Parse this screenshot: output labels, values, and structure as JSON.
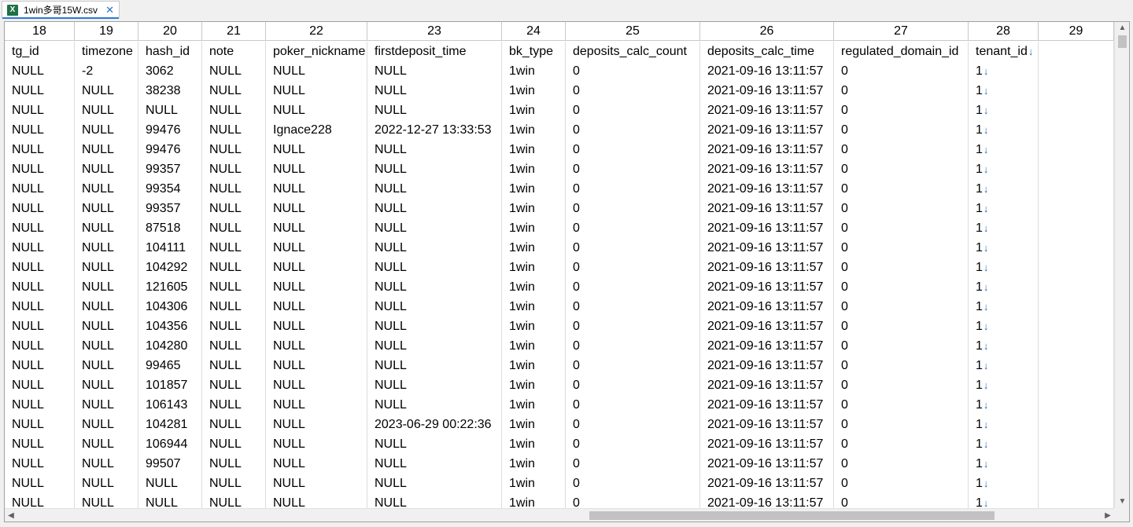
{
  "tab": {
    "title": "1win多哥15W.csv",
    "close": "✕",
    "icon_letter": "X"
  },
  "column_numbers": [
    "18",
    "19",
    "20",
    "21",
    "22",
    "23",
    "24",
    "25",
    "26",
    "27",
    "28",
    "29"
  ],
  "headers": [
    "tg_id",
    "timezone",
    "hash_id",
    "note",
    "poker_nickname",
    "firstdeposit_time",
    "bk_type",
    "deposits_calc_count",
    "deposits_calc_time",
    "regulated_domain_id",
    "tenant_id",
    ""
  ],
  "rows": [
    [
      "NULL",
      "-2",
      "3062",
      "NULL",
      "NULL",
      "NULL",
      "1win",
      "0",
      "2021-09-16 13:11:57",
      "0",
      "1",
      ""
    ],
    [
      "NULL",
      "NULL",
      "38238",
      "NULL",
      "NULL",
      "NULL",
      "1win",
      "0",
      "2021-09-16 13:11:57",
      "0",
      "1",
      ""
    ],
    [
      "NULL",
      "NULL",
      "NULL",
      "NULL",
      "NULL",
      "NULL",
      "1win",
      "0",
      "2021-09-16 13:11:57",
      "0",
      "1",
      ""
    ],
    [
      "NULL",
      "NULL",
      "99476",
      "NULL",
      "Ignace228",
      "2022-12-27 13:33:53",
      "1win",
      "0",
      "2021-09-16 13:11:57",
      "0",
      "1",
      ""
    ],
    [
      "NULL",
      "NULL",
      "99476",
      "NULL",
      "NULL",
      "NULL",
      "1win",
      "0",
      "2021-09-16 13:11:57",
      "0",
      "1",
      ""
    ],
    [
      "NULL",
      "NULL",
      "99357",
      "NULL",
      "NULL",
      "NULL",
      "1win",
      "0",
      "2021-09-16 13:11:57",
      "0",
      "1",
      ""
    ],
    [
      "NULL",
      "NULL",
      "99354",
      "NULL",
      "NULL",
      "NULL",
      "1win",
      "0",
      "2021-09-16 13:11:57",
      "0",
      "1",
      ""
    ],
    [
      "NULL",
      "NULL",
      "99357",
      "NULL",
      "NULL",
      "NULL",
      "1win",
      "0",
      "2021-09-16 13:11:57",
      "0",
      "1",
      ""
    ],
    [
      "NULL",
      "NULL",
      "87518",
      "NULL",
      "NULL",
      "NULL",
      "1win",
      "0",
      "2021-09-16 13:11:57",
      "0",
      "1",
      ""
    ],
    [
      "NULL",
      "NULL",
      "104111",
      "NULL",
      "NULL",
      "NULL",
      "1win",
      "0",
      "2021-09-16 13:11:57",
      "0",
      "1",
      ""
    ],
    [
      "NULL",
      "NULL",
      "104292",
      "NULL",
      "NULL",
      "NULL",
      "1win",
      "0",
      "2021-09-16 13:11:57",
      "0",
      "1",
      ""
    ],
    [
      "NULL",
      "NULL",
      "121605",
      "NULL",
      "NULL",
      "NULL",
      "1win",
      "0",
      "2021-09-16 13:11:57",
      "0",
      "1",
      ""
    ],
    [
      "NULL",
      "NULL",
      "104306",
      "NULL",
      "NULL",
      "NULL",
      "1win",
      "0",
      "2021-09-16 13:11:57",
      "0",
      "1",
      ""
    ],
    [
      "NULL",
      "NULL",
      "104356",
      "NULL",
      "NULL",
      "NULL",
      "1win",
      "0",
      "2021-09-16 13:11:57",
      "0",
      "1",
      ""
    ],
    [
      "NULL",
      "NULL",
      "104280",
      "NULL",
      "NULL",
      "NULL",
      "1win",
      "0",
      "2021-09-16 13:11:57",
      "0",
      "1",
      ""
    ],
    [
      "NULL",
      "NULL",
      "99465",
      "NULL",
      "NULL",
      "NULL",
      "1win",
      "0",
      "2021-09-16 13:11:57",
      "0",
      "1",
      ""
    ],
    [
      "NULL",
      "NULL",
      "101857",
      "NULL",
      "NULL",
      "NULL",
      "1win",
      "0",
      "2021-09-16 13:11:57",
      "0",
      "1",
      ""
    ],
    [
      "NULL",
      "NULL",
      "106143",
      "NULL",
      "NULL",
      "NULL",
      "1win",
      "0",
      "2021-09-16 13:11:57",
      "0",
      "1",
      ""
    ],
    [
      "NULL",
      "NULL",
      "104281",
      "NULL",
      "NULL",
      "2023-06-29 00:22:36",
      "1win",
      "0",
      "2021-09-16 13:11:57",
      "0",
      "1",
      ""
    ],
    [
      "NULL",
      "NULL",
      "106944",
      "NULL",
      "NULL",
      "NULL",
      "1win",
      "0",
      "2021-09-16 13:11:57",
      "0",
      "1",
      ""
    ],
    [
      "NULL",
      "NULL",
      "99507",
      "NULL",
      "NULL",
      "NULL",
      "1win",
      "0",
      "2021-09-16 13:11:57",
      "0",
      "1",
      ""
    ],
    [
      "NULL",
      "NULL",
      "NULL",
      "NULL",
      "NULL",
      "NULL",
      "1win",
      "0",
      "2021-09-16 13:11:57",
      "0",
      "1",
      ""
    ],
    [
      "NULL",
      "NULL",
      "NULL",
      "NULL",
      "NULL",
      "NULL",
      "1win",
      "0",
      "2021-09-16 13:11:57",
      "0",
      "1",
      ""
    ]
  ],
  "newline_marker": "↓",
  "scrollbar": {
    "up": "▲",
    "down": "▼",
    "left": "◀",
    "right": "▶"
  }
}
